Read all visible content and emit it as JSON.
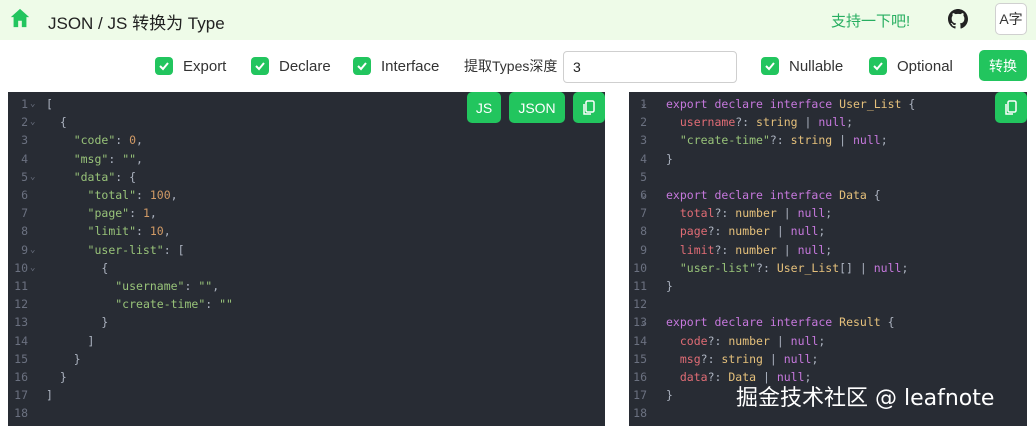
{
  "header": {
    "title": "JSON / JS 转换为 Type",
    "support_label": "支持一下吧!",
    "translate_label": "A字"
  },
  "options": {
    "export_label": "Export",
    "declare_label": "Declare",
    "interface_label": "Interface",
    "depth_label": "提取Types深度",
    "depth_value": "3",
    "nullable_label": "Nullable",
    "optional_label": "Optional",
    "convert_label": "转换"
  },
  "left_editor": {
    "js_button": "JS",
    "json_button": "JSON",
    "lines": [
      [
        [
          "[",
          "punc"
        ]
      ],
      [
        [
          "  {",
          "punc"
        ]
      ],
      [
        [
          "    ",
          "punc"
        ],
        [
          "\"code\"",
          "key"
        ],
        [
          ": ",
          "punc"
        ],
        [
          "0",
          "num"
        ],
        [
          ",",
          "punc"
        ]
      ],
      [
        [
          "    ",
          "punc"
        ],
        [
          "\"msg\"",
          "key"
        ],
        [
          ": ",
          "punc"
        ],
        [
          "\"\"",
          "str"
        ],
        [
          ",",
          "punc"
        ]
      ],
      [
        [
          "    ",
          "punc"
        ],
        [
          "\"data\"",
          "key"
        ],
        [
          ": {",
          "punc"
        ]
      ],
      [
        [
          "      ",
          "punc"
        ],
        [
          "\"total\"",
          "key"
        ],
        [
          ": ",
          "punc"
        ],
        [
          "100",
          "num"
        ],
        [
          ",",
          "punc"
        ]
      ],
      [
        [
          "      ",
          "punc"
        ],
        [
          "\"page\"",
          "key"
        ],
        [
          ": ",
          "punc"
        ],
        [
          "1",
          "num"
        ],
        [
          ",",
          "punc"
        ]
      ],
      [
        [
          "      ",
          "punc"
        ],
        [
          "\"limit\"",
          "key"
        ],
        [
          ": ",
          "punc"
        ],
        [
          "10",
          "num"
        ],
        [
          ",",
          "punc"
        ]
      ],
      [
        [
          "      ",
          "punc"
        ],
        [
          "\"user-list\"",
          "key"
        ],
        [
          ": [",
          "punc"
        ]
      ],
      [
        [
          "        {",
          "punc"
        ]
      ],
      [
        [
          "          ",
          "punc"
        ],
        [
          "\"username\"",
          "key"
        ],
        [
          ": ",
          "punc"
        ],
        [
          "\"\"",
          "str"
        ],
        [
          ",",
          "punc"
        ]
      ],
      [
        [
          "          ",
          "punc"
        ],
        [
          "\"create-time\"",
          "key"
        ],
        [
          ": ",
          "punc"
        ],
        [
          "\"\"",
          "str"
        ]
      ],
      [
        [
          "        }",
          "punc"
        ]
      ],
      [
        [
          "      ]",
          "punc"
        ]
      ],
      [
        [
          "    }",
          "punc"
        ]
      ],
      [
        [
          "  }",
          "punc"
        ]
      ],
      [
        [
          "]",
          "punc"
        ]
      ],
      []
    ],
    "folds": [
      1,
      2,
      5,
      9,
      10
    ]
  },
  "right_editor": {
    "lines": [
      [
        [
          "export",
          "kw"
        ],
        [
          " ",
          "punc"
        ],
        [
          "declare",
          "kw"
        ],
        [
          " ",
          "punc"
        ],
        [
          "interface",
          "kw"
        ],
        [
          " ",
          "punc"
        ],
        [
          "User_List",
          "cls"
        ],
        [
          " {",
          "punc"
        ]
      ],
      [
        [
          "  ",
          "punc"
        ],
        [
          "username",
          "prop"
        ],
        [
          "?: ",
          "punc"
        ],
        [
          "string",
          "type"
        ],
        [
          " | ",
          "punc"
        ],
        [
          "null",
          "kw"
        ],
        [
          ";",
          "punc"
        ]
      ],
      [
        [
          "  ",
          "punc"
        ],
        [
          "\"create-time\"",
          "key"
        ],
        [
          "?: ",
          "punc"
        ],
        [
          "string",
          "type"
        ],
        [
          " | ",
          "punc"
        ],
        [
          "null",
          "kw"
        ],
        [
          ";",
          "punc"
        ]
      ],
      [
        [
          "}",
          "punc"
        ]
      ],
      [],
      [
        [
          "export",
          "kw"
        ],
        [
          " ",
          "punc"
        ],
        [
          "declare",
          "kw"
        ],
        [
          " ",
          "punc"
        ],
        [
          "interface",
          "kw"
        ],
        [
          " ",
          "punc"
        ],
        [
          "Data",
          "cls"
        ],
        [
          " {",
          "punc"
        ]
      ],
      [
        [
          "  ",
          "punc"
        ],
        [
          "total",
          "prop"
        ],
        [
          "?: ",
          "punc"
        ],
        [
          "number",
          "type"
        ],
        [
          " | ",
          "punc"
        ],
        [
          "null",
          "kw"
        ],
        [
          ";",
          "punc"
        ]
      ],
      [
        [
          "  ",
          "punc"
        ],
        [
          "page",
          "prop"
        ],
        [
          "?: ",
          "punc"
        ],
        [
          "number",
          "type"
        ],
        [
          " | ",
          "punc"
        ],
        [
          "null",
          "kw"
        ],
        [
          ";",
          "punc"
        ]
      ],
      [
        [
          "  ",
          "punc"
        ],
        [
          "limit",
          "prop"
        ],
        [
          "?: ",
          "punc"
        ],
        [
          "number",
          "type"
        ],
        [
          " | ",
          "punc"
        ],
        [
          "null",
          "kw"
        ],
        [
          ";",
          "punc"
        ]
      ],
      [
        [
          "  ",
          "punc"
        ],
        [
          "\"user-list\"",
          "key"
        ],
        [
          "?: ",
          "punc"
        ],
        [
          "User_List",
          "cls"
        ],
        [
          "[] | ",
          "punc"
        ],
        [
          "null",
          "kw"
        ],
        [
          ";",
          "punc"
        ]
      ],
      [
        [
          "}",
          "punc"
        ]
      ],
      [],
      [
        [
          "export",
          "kw"
        ],
        [
          " ",
          "punc"
        ],
        [
          "declare",
          "kw"
        ],
        [
          " ",
          "punc"
        ],
        [
          "interface",
          "kw"
        ],
        [
          " ",
          "punc"
        ],
        [
          "Result",
          "cls"
        ],
        [
          " {",
          "punc"
        ]
      ],
      [
        [
          "  ",
          "punc"
        ],
        [
          "code",
          "prop"
        ],
        [
          "?: ",
          "punc"
        ],
        [
          "number",
          "type"
        ],
        [
          " | ",
          "punc"
        ],
        [
          "null",
          "kw"
        ],
        [
          ";",
          "punc"
        ]
      ],
      [
        [
          "  ",
          "punc"
        ],
        [
          "msg",
          "prop"
        ],
        [
          "?: ",
          "punc"
        ],
        [
          "string",
          "type"
        ],
        [
          " | ",
          "punc"
        ],
        [
          "null",
          "kw"
        ],
        [
          ";",
          "punc"
        ]
      ],
      [
        [
          "  ",
          "punc"
        ],
        [
          "data",
          "prop"
        ],
        [
          "?: ",
          "punc"
        ],
        [
          "Data",
          "cls"
        ],
        [
          " | ",
          "punc"
        ],
        [
          "null",
          "kw"
        ],
        [
          ";",
          "punc"
        ]
      ],
      [
        [
          "}",
          "punc"
        ]
      ],
      []
    ],
    "folds": [
      1,
      6,
      13
    ]
  },
  "watermark": "掘金技术社区 @ leafnote",
  "colors": {
    "accent": "#22c55e",
    "header_bg": "#eefbe8",
    "editor_bg": "#282c34"
  },
  "icons": [
    "home-icon",
    "github-icon",
    "translate-icon",
    "check-icon",
    "copy-icon",
    "fold-chevron-icon"
  ]
}
